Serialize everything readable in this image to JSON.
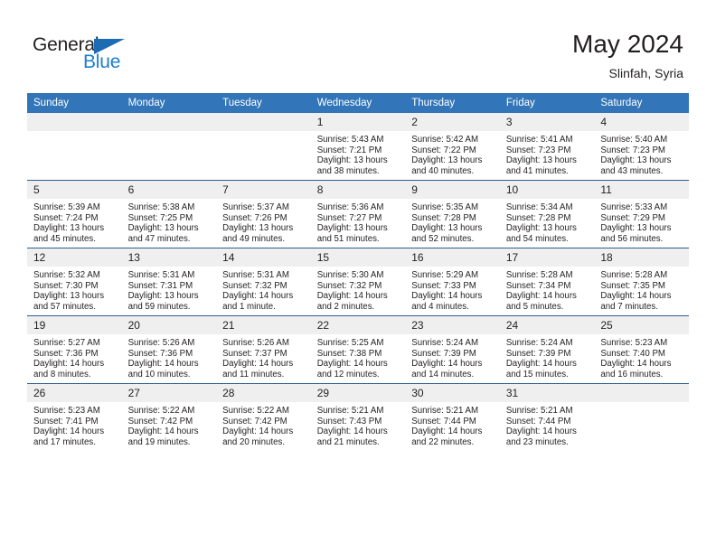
{
  "brand": {
    "name_part1": "General",
    "name_part2": "Blue",
    "triangle_icon": "triangle-icon",
    "color_dark": "#231f20",
    "color_blue": "#1b7ed0"
  },
  "header": {
    "title": "May 2024",
    "subtitle": "Slinfah, Syria"
  },
  "theme": {
    "header_blue": "#3275b8",
    "row_rule": "#2e5f8f",
    "daynum_band": "#efefef"
  },
  "weekdays": [
    "Sunday",
    "Monday",
    "Tuesday",
    "Wednesday",
    "Thursday",
    "Friday",
    "Saturday"
  ],
  "weeks": [
    [
      {
        "day": "",
        "sunrise": "",
        "sunset": "",
        "daylight1": "",
        "daylight2": ""
      },
      {
        "day": "",
        "sunrise": "",
        "sunset": "",
        "daylight1": "",
        "daylight2": ""
      },
      {
        "day": "",
        "sunrise": "",
        "sunset": "",
        "daylight1": "",
        "daylight2": ""
      },
      {
        "day": "1",
        "sunrise": "Sunrise: 5:43 AM",
        "sunset": "Sunset: 7:21 PM",
        "daylight1": "Daylight: 13 hours",
        "daylight2": "and 38 minutes."
      },
      {
        "day": "2",
        "sunrise": "Sunrise: 5:42 AM",
        "sunset": "Sunset: 7:22 PM",
        "daylight1": "Daylight: 13 hours",
        "daylight2": "and 40 minutes."
      },
      {
        "day": "3",
        "sunrise": "Sunrise: 5:41 AM",
        "sunset": "Sunset: 7:23 PM",
        "daylight1": "Daylight: 13 hours",
        "daylight2": "and 41 minutes."
      },
      {
        "day": "4",
        "sunrise": "Sunrise: 5:40 AM",
        "sunset": "Sunset: 7:23 PM",
        "daylight1": "Daylight: 13 hours",
        "daylight2": "and 43 minutes."
      }
    ],
    [
      {
        "day": "5",
        "sunrise": "Sunrise: 5:39 AM",
        "sunset": "Sunset: 7:24 PM",
        "daylight1": "Daylight: 13 hours",
        "daylight2": "and 45 minutes."
      },
      {
        "day": "6",
        "sunrise": "Sunrise: 5:38 AM",
        "sunset": "Sunset: 7:25 PM",
        "daylight1": "Daylight: 13 hours",
        "daylight2": "and 47 minutes."
      },
      {
        "day": "7",
        "sunrise": "Sunrise: 5:37 AM",
        "sunset": "Sunset: 7:26 PM",
        "daylight1": "Daylight: 13 hours",
        "daylight2": "and 49 minutes."
      },
      {
        "day": "8",
        "sunrise": "Sunrise: 5:36 AM",
        "sunset": "Sunset: 7:27 PM",
        "daylight1": "Daylight: 13 hours",
        "daylight2": "and 51 minutes."
      },
      {
        "day": "9",
        "sunrise": "Sunrise: 5:35 AM",
        "sunset": "Sunset: 7:28 PM",
        "daylight1": "Daylight: 13 hours",
        "daylight2": "and 52 minutes."
      },
      {
        "day": "10",
        "sunrise": "Sunrise: 5:34 AM",
        "sunset": "Sunset: 7:28 PM",
        "daylight1": "Daylight: 13 hours",
        "daylight2": "and 54 minutes."
      },
      {
        "day": "11",
        "sunrise": "Sunrise: 5:33 AM",
        "sunset": "Sunset: 7:29 PM",
        "daylight1": "Daylight: 13 hours",
        "daylight2": "and 56 minutes."
      }
    ],
    [
      {
        "day": "12",
        "sunrise": "Sunrise: 5:32 AM",
        "sunset": "Sunset: 7:30 PM",
        "daylight1": "Daylight: 13 hours",
        "daylight2": "and 57 minutes."
      },
      {
        "day": "13",
        "sunrise": "Sunrise: 5:31 AM",
        "sunset": "Sunset: 7:31 PM",
        "daylight1": "Daylight: 13 hours",
        "daylight2": "and 59 minutes."
      },
      {
        "day": "14",
        "sunrise": "Sunrise: 5:31 AM",
        "sunset": "Sunset: 7:32 PM",
        "daylight1": "Daylight: 14 hours",
        "daylight2": "and 1 minute."
      },
      {
        "day": "15",
        "sunrise": "Sunrise: 5:30 AM",
        "sunset": "Sunset: 7:32 PM",
        "daylight1": "Daylight: 14 hours",
        "daylight2": "and 2 minutes."
      },
      {
        "day": "16",
        "sunrise": "Sunrise: 5:29 AM",
        "sunset": "Sunset: 7:33 PM",
        "daylight1": "Daylight: 14 hours",
        "daylight2": "and 4 minutes."
      },
      {
        "day": "17",
        "sunrise": "Sunrise: 5:28 AM",
        "sunset": "Sunset: 7:34 PM",
        "daylight1": "Daylight: 14 hours",
        "daylight2": "and 5 minutes."
      },
      {
        "day": "18",
        "sunrise": "Sunrise: 5:28 AM",
        "sunset": "Sunset: 7:35 PM",
        "daylight1": "Daylight: 14 hours",
        "daylight2": "and 7 minutes."
      }
    ],
    [
      {
        "day": "19",
        "sunrise": "Sunrise: 5:27 AM",
        "sunset": "Sunset: 7:36 PM",
        "daylight1": "Daylight: 14 hours",
        "daylight2": "and 8 minutes."
      },
      {
        "day": "20",
        "sunrise": "Sunrise: 5:26 AM",
        "sunset": "Sunset: 7:36 PM",
        "daylight1": "Daylight: 14 hours",
        "daylight2": "and 10 minutes."
      },
      {
        "day": "21",
        "sunrise": "Sunrise: 5:26 AM",
        "sunset": "Sunset: 7:37 PM",
        "daylight1": "Daylight: 14 hours",
        "daylight2": "and 11 minutes."
      },
      {
        "day": "22",
        "sunrise": "Sunrise: 5:25 AM",
        "sunset": "Sunset: 7:38 PM",
        "daylight1": "Daylight: 14 hours",
        "daylight2": "and 12 minutes."
      },
      {
        "day": "23",
        "sunrise": "Sunrise: 5:24 AM",
        "sunset": "Sunset: 7:39 PM",
        "daylight1": "Daylight: 14 hours",
        "daylight2": "and 14 minutes."
      },
      {
        "day": "24",
        "sunrise": "Sunrise: 5:24 AM",
        "sunset": "Sunset: 7:39 PM",
        "daylight1": "Daylight: 14 hours",
        "daylight2": "and 15 minutes."
      },
      {
        "day": "25",
        "sunrise": "Sunrise: 5:23 AM",
        "sunset": "Sunset: 7:40 PM",
        "daylight1": "Daylight: 14 hours",
        "daylight2": "and 16 minutes."
      }
    ],
    [
      {
        "day": "26",
        "sunrise": "Sunrise: 5:23 AM",
        "sunset": "Sunset: 7:41 PM",
        "daylight1": "Daylight: 14 hours",
        "daylight2": "and 17 minutes."
      },
      {
        "day": "27",
        "sunrise": "Sunrise: 5:22 AM",
        "sunset": "Sunset: 7:42 PM",
        "daylight1": "Daylight: 14 hours",
        "daylight2": "and 19 minutes."
      },
      {
        "day": "28",
        "sunrise": "Sunrise: 5:22 AM",
        "sunset": "Sunset: 7:42 PM",
        "daylight1": "Daylight: 14 hours",
        "daylight2": "and 20 minutes."
      },
      {
        "day": "29",
        "sunrise": "Sunrise: 5:21 AM",
        "sunset": "Sunset: 7:43 PM",
        "daylight1": "Daylight: 14 hours",
        "daylight2": "and 21 minutes."
      },
      {
        "day": "30",
        "sunrise": "Sunrise: 5:21 AM",
        "sunset": "Sunset: 7:44 PM",
        "daylight1": "Daylight: 14 hours",
        "daylight2": "and 22 minutes."
      },
      {
        "day": "31",
        "sunrise": "Sunrise: 5:21 AM",
        "sunset": "Sunset: 7:44 PM",
        "daylight1": "Daylight: 14 hours",
        "daylight2": "and 23 minutes."
      },
      {
        "day": "",
        "sunrise": "",
        "sunset": "",
        "daylight1": "",
        "daylight2": ""
      }
    ]
  ]
}
